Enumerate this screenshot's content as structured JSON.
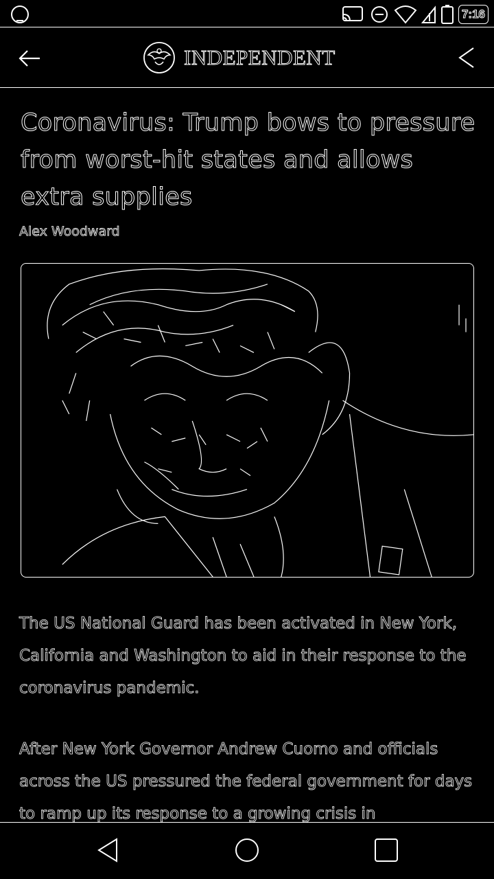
{
  "status_bar": {
    "time": "7:16",
    "icons": [
      "notification-icon",
      "cast-icon",
      "alarm-icon",
      "wifi-icon",
      "signal-icon",
      "battery-icon"
    ]
  },
  "header": {
    "brand": "INDEPENDENT",
    "back_icon": "arrow-left-icon",
    "share_icon": "share-icon"
  },
  "article": {
    "headline": "Coronavirus: Trump bows to pressure from worst-hit states and allows extra supplies",
    "author": "Alex Woodward",
    "image_icon": "article-photo",
    "paragraphs": [
      "The US National Guard has been activated in New York, California and Washington to aid in their response to the coronavirus pandemic.",
      "After New York Governor Andrew Cuomo and officials across the US pressured the federal government for days to ramp up its response to a growing crisis in"
    ]
  },
  "nav_bar": {
    "items": [
      "back-triangle-icon",
      "home-circle-icon",
      "recents-square-icon"
    ]
  },
  "colors": {
    "background": "#000000",
    "foreground": "#ffffff"
  }
}
